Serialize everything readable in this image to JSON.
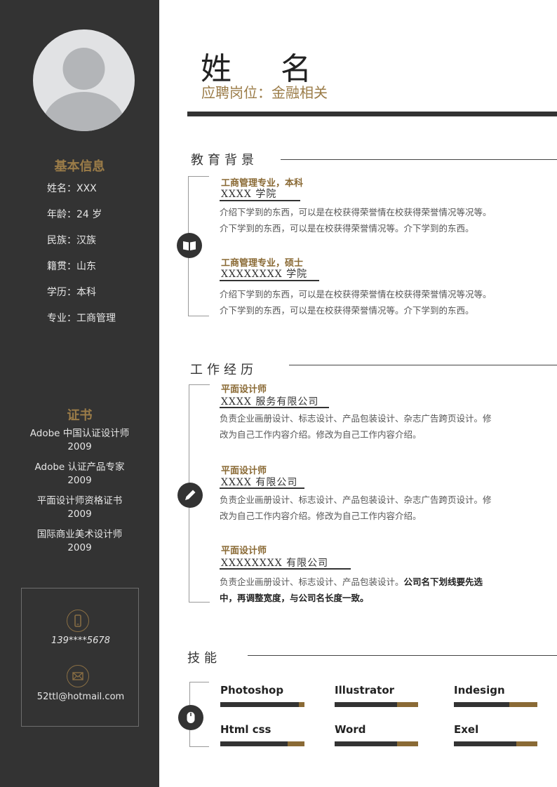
{
  "header": {
    "name": "姓  名",
    "position": "应聘岗位：金融相关"
  },
  "sidebar": {
    "basic_title": "基本信息",
    "basic_info": [
      {
        "label": "姓名：",
        "value": "XXX"
      },
      {
        "label": "年龄：",
        "value": "24 岁"
      },
      {
        "label": "民族：",
        "value": "汉族"
      },
      {
        "label": "籍贯：",
        "value": "山东"
      },
      {
        "label": "学历：",
        "value": "本科"
      },
      {
        "label": "专业：",
        "value": "工商管理"
      }
    ],
    "cert_title": "证书",
    "certificates": [
      {
        "name": "Adobe 中国认证设计师",
        "year": "2009"
      },
      {
        "name": "Adobe 认证产品专家",
        "year": "2009"
      },
      {
        "name": "平面设计师资格证书",
        "year": "2009"
      },
      {
        "name": "国际商业美术设计师",
        "year": "2009"
      }
    ],
    "contact": {
      "phone": "139****5678",
      "email": "52ttl@hotmail.com"
    }
  },
  "education": {
    "title": "教育背景",
    "items": [
      {
        "title": "工商管理专业，本科",
        "school": "XXXX 学院",
        "desc1": "介绍下学到的东西，可以是在校获得荣誉情在校获得荣誉情况等况等。",
        "desc2": "介下学到的东西，可以是在校获得荣誉情况等。介下学到的东西。"
      },
      {
        "title": "工商管理专业，硕士",
        "school": "XXXXXXXX 学院",
        "desc1": "介绍下学到的东西，可以是在校获得荣誉情在校获得荣誉情况等况等。",
        "desc2": "介下学到的东西，可以是在校获得荣誉情况等。介下学到的东西。"
      }
    ]
  },
  "work": {
    "title": "工作经历",
    "items": [
      {
        "title": "平面设计师",
        "company": "XXXX 服务有限公司",
        "desc1": "负责企业画册设计、标志设计、产品包装设计、杂志广告跨页设计。修",
        "desc2": "改为自己工作内容介绍。修改为自己工作内容介绍。"
      },
      {
        "title": "平面设计师",
        "company": "XXXX 有限公司",
        "desc1": "负责企业画册设计、标志设计、产品包装设计、杂志广告跨页设计。修",
        "desc2": "改为自己工作内容介绍。修改为自己工作内容介绍。"
      },
      {
        "title": "平面设计师",
        "company": "XXXXXXXX 有限公司",
        "desc1": "负责企业画册设计、标志设计、产品包装设计。",
        "desc1_bold": "公司名下划线要先选",
        "desc2_bold": "中，再调整宽度，与公司名长度一致。"
      }
    ]
  },
  "skills": {
    "title": "技能",
    "items": [
      {
        "name": "Photoshop",
        "level": 0.93
      },
      {
        "name": "Illustrator",
        "level": 0.75
      },
      {
        "name": "Indesign",
        "level": 0.66
      },
      {
        "name": "Html css",
        "level": 0.8
      },
      {
        "name": "Word",
        "level": 0.75
      },
      {
        "name": "Exel",
        "level": 0.75
      }
    ]
  },
  "colors": {
    "sidebar_bg": "#333333",
    "accent_gold": "#9b7c48",
    "dark": "#333333"
  }
}
